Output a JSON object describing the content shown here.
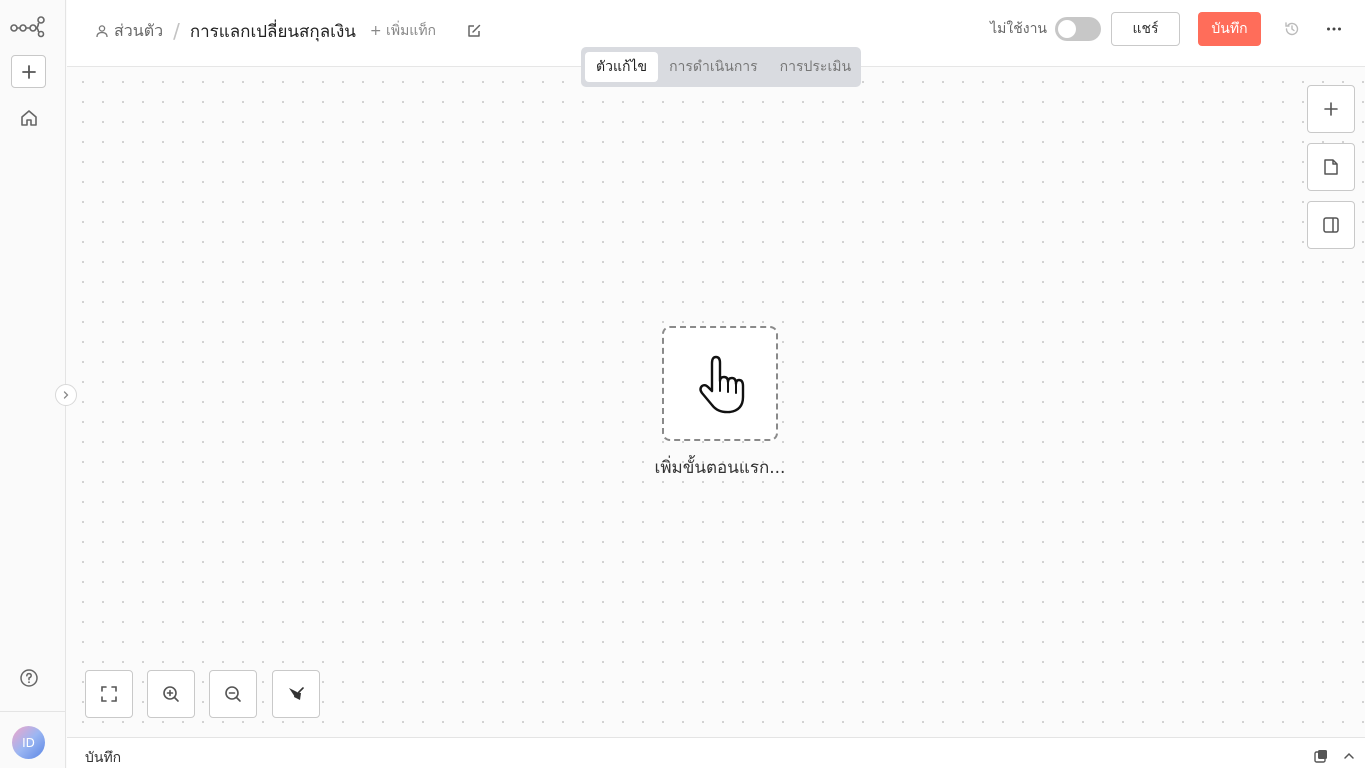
{
  "header": {
    "project": "ส่วนตัว",
    "separator": "/",
    "workflow_title": "การแลกเปลี่ยนสกุลเงิน",
    "add_tag": "+ เพิ่มแท็ก",
    "inactive_label": "ไม่ใช้งาน",
    "active": false,
    "share_label": "แชร์",
    "save_label": "บันทึก"
  },
  "tabs": [
    {
      "label": "ตัวแก้ไข",
      "active": true
    },
    {
      "label": "การดำเนินการ",
      "active": false
    },
    {
      "label": "การประเมิน",
      "active": false
    }
  ],
  "sidebar": {
    "user_initials": "ID"
  },
  "canvas": {
    "trigger_label": "เพิ่มขั้นตอนแรก..."
  },
  "log_panel": {
    "label": "บันทึก"
  },
  "colors": {
    "save_button": "#ff6d5a",
    "tab_bar": "#d9dbe0"
  },
  "icons": {
    "logo": "workflow-logo-icon",
    "new": "plus-icon",
    "home": "home-icon",
    "help": "help-icon",
    "history": "history-icon",
    "more": "more-horizontal-icon",
    "trigger": "pointer-hand-icon"
  }
}
